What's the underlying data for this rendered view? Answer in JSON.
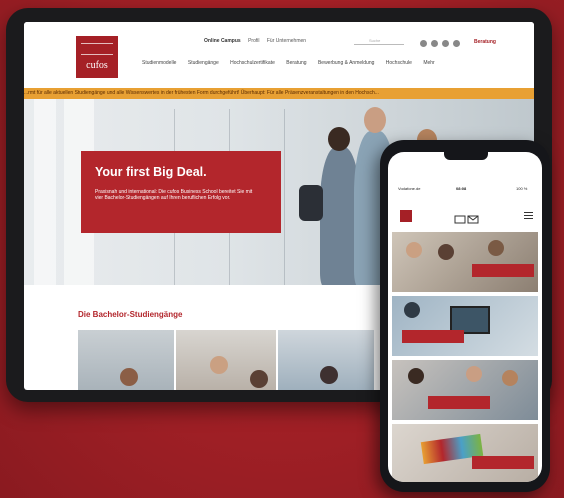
{
  "tablet": {
    "logo_text": "cufos",
    "util_links": [
      "Online Campus",
      "Profil",
      "Für Unternehmen"
    ],
    "search_placeholder": "Suche",
    "beratung": "Beratung",
    "nav_items": [
      "Studienmodelle",
      "Studiengänge",
      "Hochschulzertifikate",
      "Beratung",
      "Bewerbung & Anmeldung",
      "Hochschule",
      "Mehr"
    ],
    "ticker_text": "...rmt für alle aktuellen Studiengänge und alle Wissenswertes in der frühesten Form durchgeführt! Überhaupt: Für alle Präsenzveranstaltungen in den Hochsch...",
    "hero": {
      "title": "Your first Big Deal.",
      "text": "Praxisnah und international: Die cufos Business School bereitet Sie mit vier Bachelor-Studiengängen auf Ihren beruflichen Erfolg vor."
    },
    "section_title": "Die Bachelor-Studiengänge"
  },
  "phone": {
    "status_left": "Vodafone.de",
    "status_time": "08:08",
    "status_right": "100 %"
  }
}
